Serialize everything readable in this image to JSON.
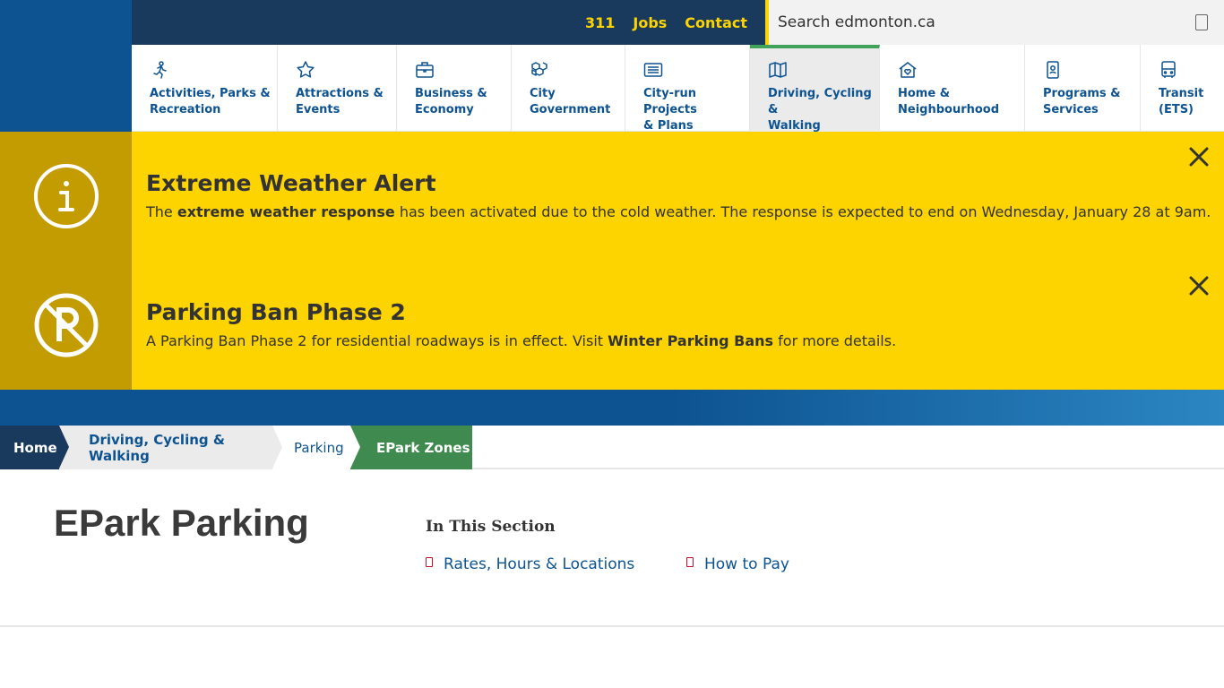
{
  "utility": {
    "links": [
      "311",
      "Jobs",
      "Contact"
    ],
    "search_placeholder": "Search edmonton.ca"
  },
  "nav": [
    {
      "label": "Activities, Parks &\nRecreation",
      "icon": "runner-icon"
    },
    {
      "label": "Attractions &\nEvents",
      "icon": "star-icon"
    },
    {
      "label": "Business &\nEconomy",
      "icon": "briefcase-icon"
    },
    {
      "label": "City\nGovernment",
      "icon": "blocks-icon"
    },
    {
      "label": "City-run Projects\n& Plans",
      "icon": "list-card-icon"
    },
    {
      "label": "Driving, Cycling &\nWalking",
      "icon": "map-icon",
      "active": true
    },
    {
      "label": "Home &\nNeighbourhood",
      "icon": "home-heart-icon"
    },
    {
      "label": "Programs &\nServices",
      "icon": "id-badge-icon"
    },
    {
      "label": "Transit\n(ETS)",
      "icon": "bus-icon"
    }
  ],
  "alerts": [
    {
      "title": "Extreme Weather Alert",
      "text_before": "The ",
      "text_bold": "extreme weather response",
      "text_after": " has been activated due to the cold weather. The response is expected to end on Wednesday, January 28 at 9am.",
      "icon": "info-icon"
    },
    {
      "title": "Parking Ban Phase 2",
      "text_before": "A Parking Ban Phase 2 for residential roadways is in effect. Visit ",
      "text_bold": "Winter Parking Bans",
      "text_after": " for more details.",
      "icon": "no-parking-icon"
    }
  ],
  "breadcrumb": [
    "Home",
    "Driving, Cycling & Walking",
    "Parking",
    "EPark Zones"
  ],
  "main": {
    "title": "EPark Parking",
    "section_heading": "In This Section",
    "section_links": [
      "Rates, Hours & Locations",
      "How to Pay"
    ]
  },
  "colors": {
    "navy": "#193a5c",
    "blue": "#0d5391",
    "yellow": "#fdd300",
    "dark_yellow": "#c29c00",
    "green": "#3f8a4e"
  }
}
